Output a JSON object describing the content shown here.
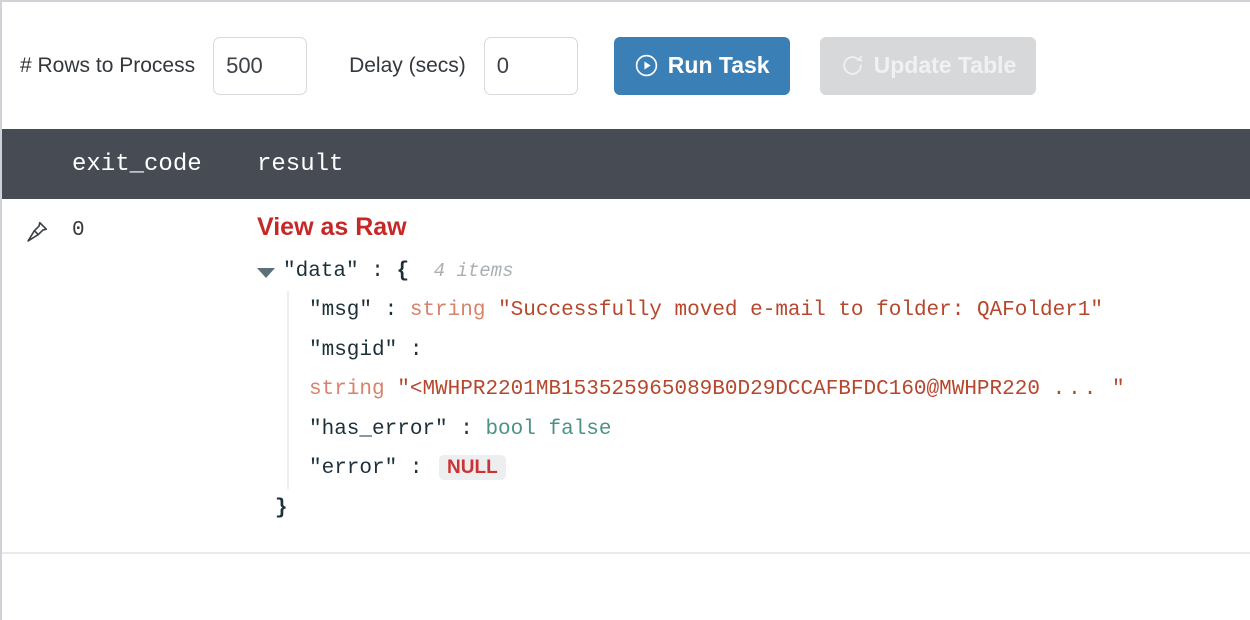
{
  "toolbar": {
    "rows_label": "# Rows to Process",
    "rows_value": "500",
    "rows_placeholder": "",
    "delay_label": "Delay (secs)",
    "delay_value": "0",
    "delay_placeholder": "",
    "run_button": "Run Task",
    "update_button": "Update Table",
    "run_button_color": "#3a7fb5",
    "update_button_color": "#d6d8da"
  },
  "table": {
    "header_bg": "#464b54",
    "columns": [
      "exit_code",
      "result"
    ],
    "rows": [
      {
        "pin_icon": "pin-icon",
        "exit_code": "0",
        "result_link": "View as Raw",
        "result_link_color": "#c62828",
        "json": {
          "root_key": "\"data\"",
          "root_colon": ":",
          "root_brace": "{",
          "items_count": "4 items",
          "close_brace": "}",
          "fields": [
            {
              "key": "\"msg\"",
              "colon": ":",
              "type": "string",
              "value": "\"Successfully moved e-mail to folder: QAFolder1\""
            },
            {
              "key": "\"msgid\"",
              "colon": ":",
              "type": "string",
              "value": "\"<MWHPR2201MB153525965089B0D29DCCAFBFDC160@MWHPR220",
              "ellipsis": "...",
              "value_tail": "\""
            },
            {
              "key": "\"has_error\"",
              "colon": ":",
              "type": "bool",
              "value": "false"
            },
            {
              "key": "\"error\"",
              "colon": ":",
              "type": "null",
              "value": "NULL"
            }
          ]
        }
      }
    ]
  }
}
